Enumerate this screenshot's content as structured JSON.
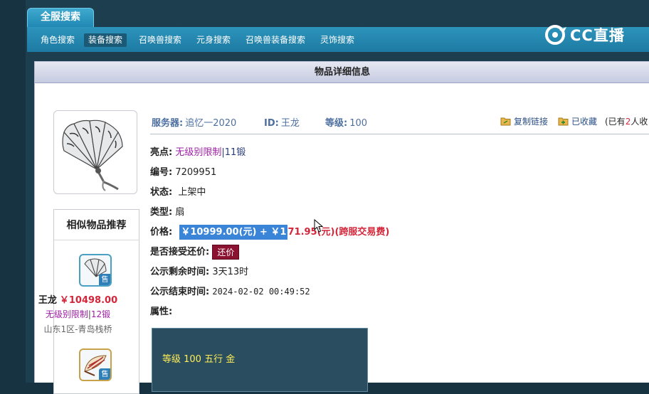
{
  "tab_title": "全服搜索",
  "nav": {
    "items": [
      {
        "label": "角色搜索",
        "active": false
      },
      {
        "label": "装备搜索",
        "active": true
      },
      {
        "label": "召唤兽搜索",
        "active": false
      },
      {
        "label": "元身搜索",
        "active": false
      },
      {
        "label": "召唤兽装备搜索",
        "active": false
      },
      {
        "label": "灵饰搜索",
        "active": false
      }
    ]
  },
  "logo": {
    "text": "CC直播"
  },
  "panel": {
    "title": "物品详细信息"
  },
  "info": {
    "server_label": "服务器:",
    "server_value": "追忆一2020",
    "id_label": "ID:",
    "id_value": "王龙",
    "level_label": "等级:",
    "level_value": "100",
    "copy_link": "复制链接",
    "favorited": "已收藏",
    "fav_prefix": "(已有",
    "fav_count": "2",
    "fav_suffix": "人收"
  },
  "details": {
    "highlight_label": "亮点:",
    "highlight_tag": "无级别限制",
    "highlight_sep": "|",
    "highlight_forge": "11锻",
    "serial_label": "编号:",
    "serial_value": "7209951",
    "status_label": "状态:",
    "status_value": "上架中",
    "type_label": "类型:",
    "type_value": "扇",
    "price_label": "价格:",
    "price_selected": "￥10999.00(元) + ￥1",
    "price_rest": "71.95(元)(跨服交易费)",
    "counter_label": "是否接受还价:",
    "counter_btn": "还价",
    "remaining_label": "公示剩余时间:",
    "remaining_value": "3天13时",
    "end_label": "公示结束时间:",
    "end_value": "2024-02-02 00:49:52",
    "attr_label": "属性:",
    "attr_text": "等级 100 五行 金"
  },
  "similar": {
    "title": "相似物品推荐",
    "sale_tag": "售",
    "item1": {
      "name": "王龙",
      "price": "￥10498.00",
      "tag": "无级别限制",
      "sep": "|",
      "forge": "12锻",
      "server": "山东1区-青岛栈桥"
    }
  },
  "colors": {
    "accent_blue": "#2d94bb",
    "price_red": "#d3263a",
    "tag_purple": "#a020a8",
    "counter_btn": "#8c1232",
    "selection": "#3a85d8",
    "attr_text": "#ffee55"
  }
}
